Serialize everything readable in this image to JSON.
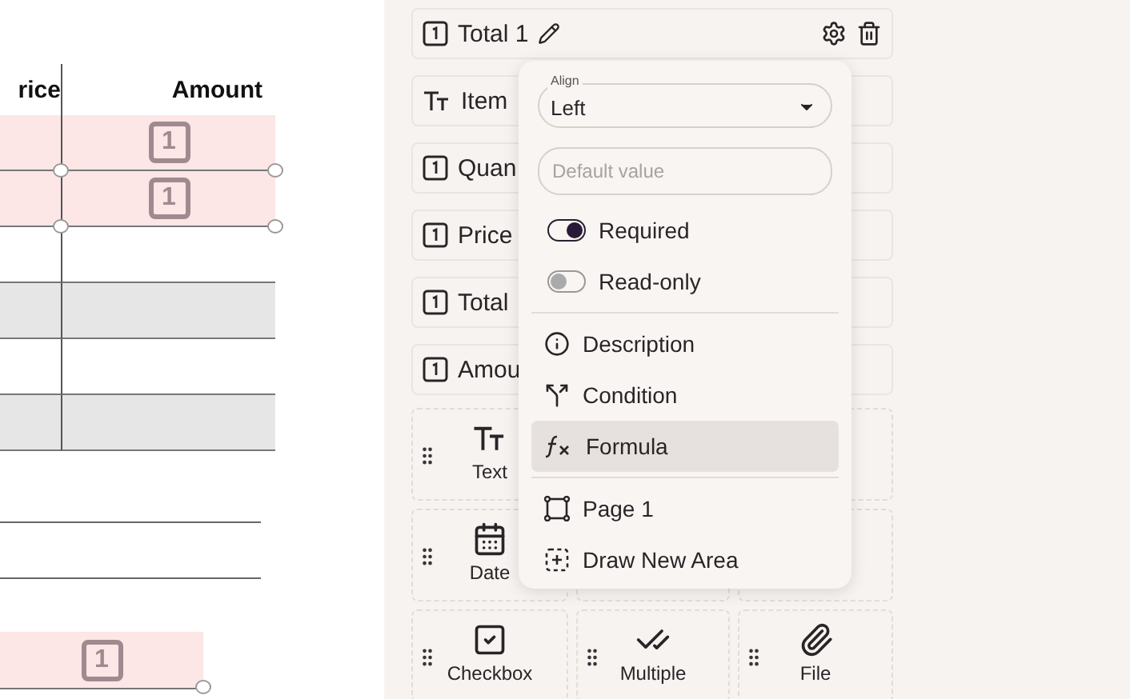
{
  "document": {
    "columns": [
      "rice",
      "Amount"
    ],
    "rows": [
      {
        "kind": "field",
        "badge": "1"
      },
      {
        "kind": "field",
        "badge": "1"
      },
      {
        "kind": "blank"
      },
      {
        "kind": "shaded"
      },
      {
        "kind": "blank"
      },
      {
        "kind": "shaded"
      }
    ],
    "lower_field": {
      "badge": "1"
    }
  },
  "fields": [
    {
      "kind": "number",
      "label": "Total 1",
      "selected": true
    },
    {
      "kind": "text",
      "label": "Item",
      "selected": false
    },
    {
      "kind": "number",
      "label": "Quan",
      "selected": false
    },
    {
      "kind": "number",
      "label": "Price",
      "selected": false
    },
    {
      "kind": "number",
      "label": "Total",
      "selected": false
    },
    {
      "kind": "number",
      "label": "Amou",
      "selected": false
    }
  ],
  "palette": [
    {
      "kind": "text",
      "label": "Text"
    },
    {
      "kind": "blank"
    },
    {
      "kind": "date",
      "label": "Date"
    },
    {
      "kind": "blank"
    },
    {
      "kind": "blank"
    },
    {
      "kind": "checkbox",
      "label": "Checkbox"
    },
    {
      "kind": "multiple",
      "label": "Multiple"
    },
    {
      "kind": "file",
      "label": "File"
    }
  ],
  "popup": {
    "align": {
      "label": "Align",
      "value": "Left"
    },
    "default_value": {
      "placeholder": "Default value"
    },
    "toggles": [
      {
        "label": "Required",
        "on": true
      },
      {
        "label": "Read-only",
        "on": false
      }
    ],
    "actions": [
      {
        "kind": "description",
        "label": "Description",
        "selected": false
      },
      {
        "kind": "condition",
        "label": "Condition",
        "selected": false
      },
      {
        "kind": "formula",
        "label": "Formula",
        "selected": true
      }
    ],
    "areas": [
      {
        "kind": "page",
        "label": "Page 1"
      },
      {
        "kind": "draw",
        "label": "Draw New Area"
      }
    ]
  }
}
